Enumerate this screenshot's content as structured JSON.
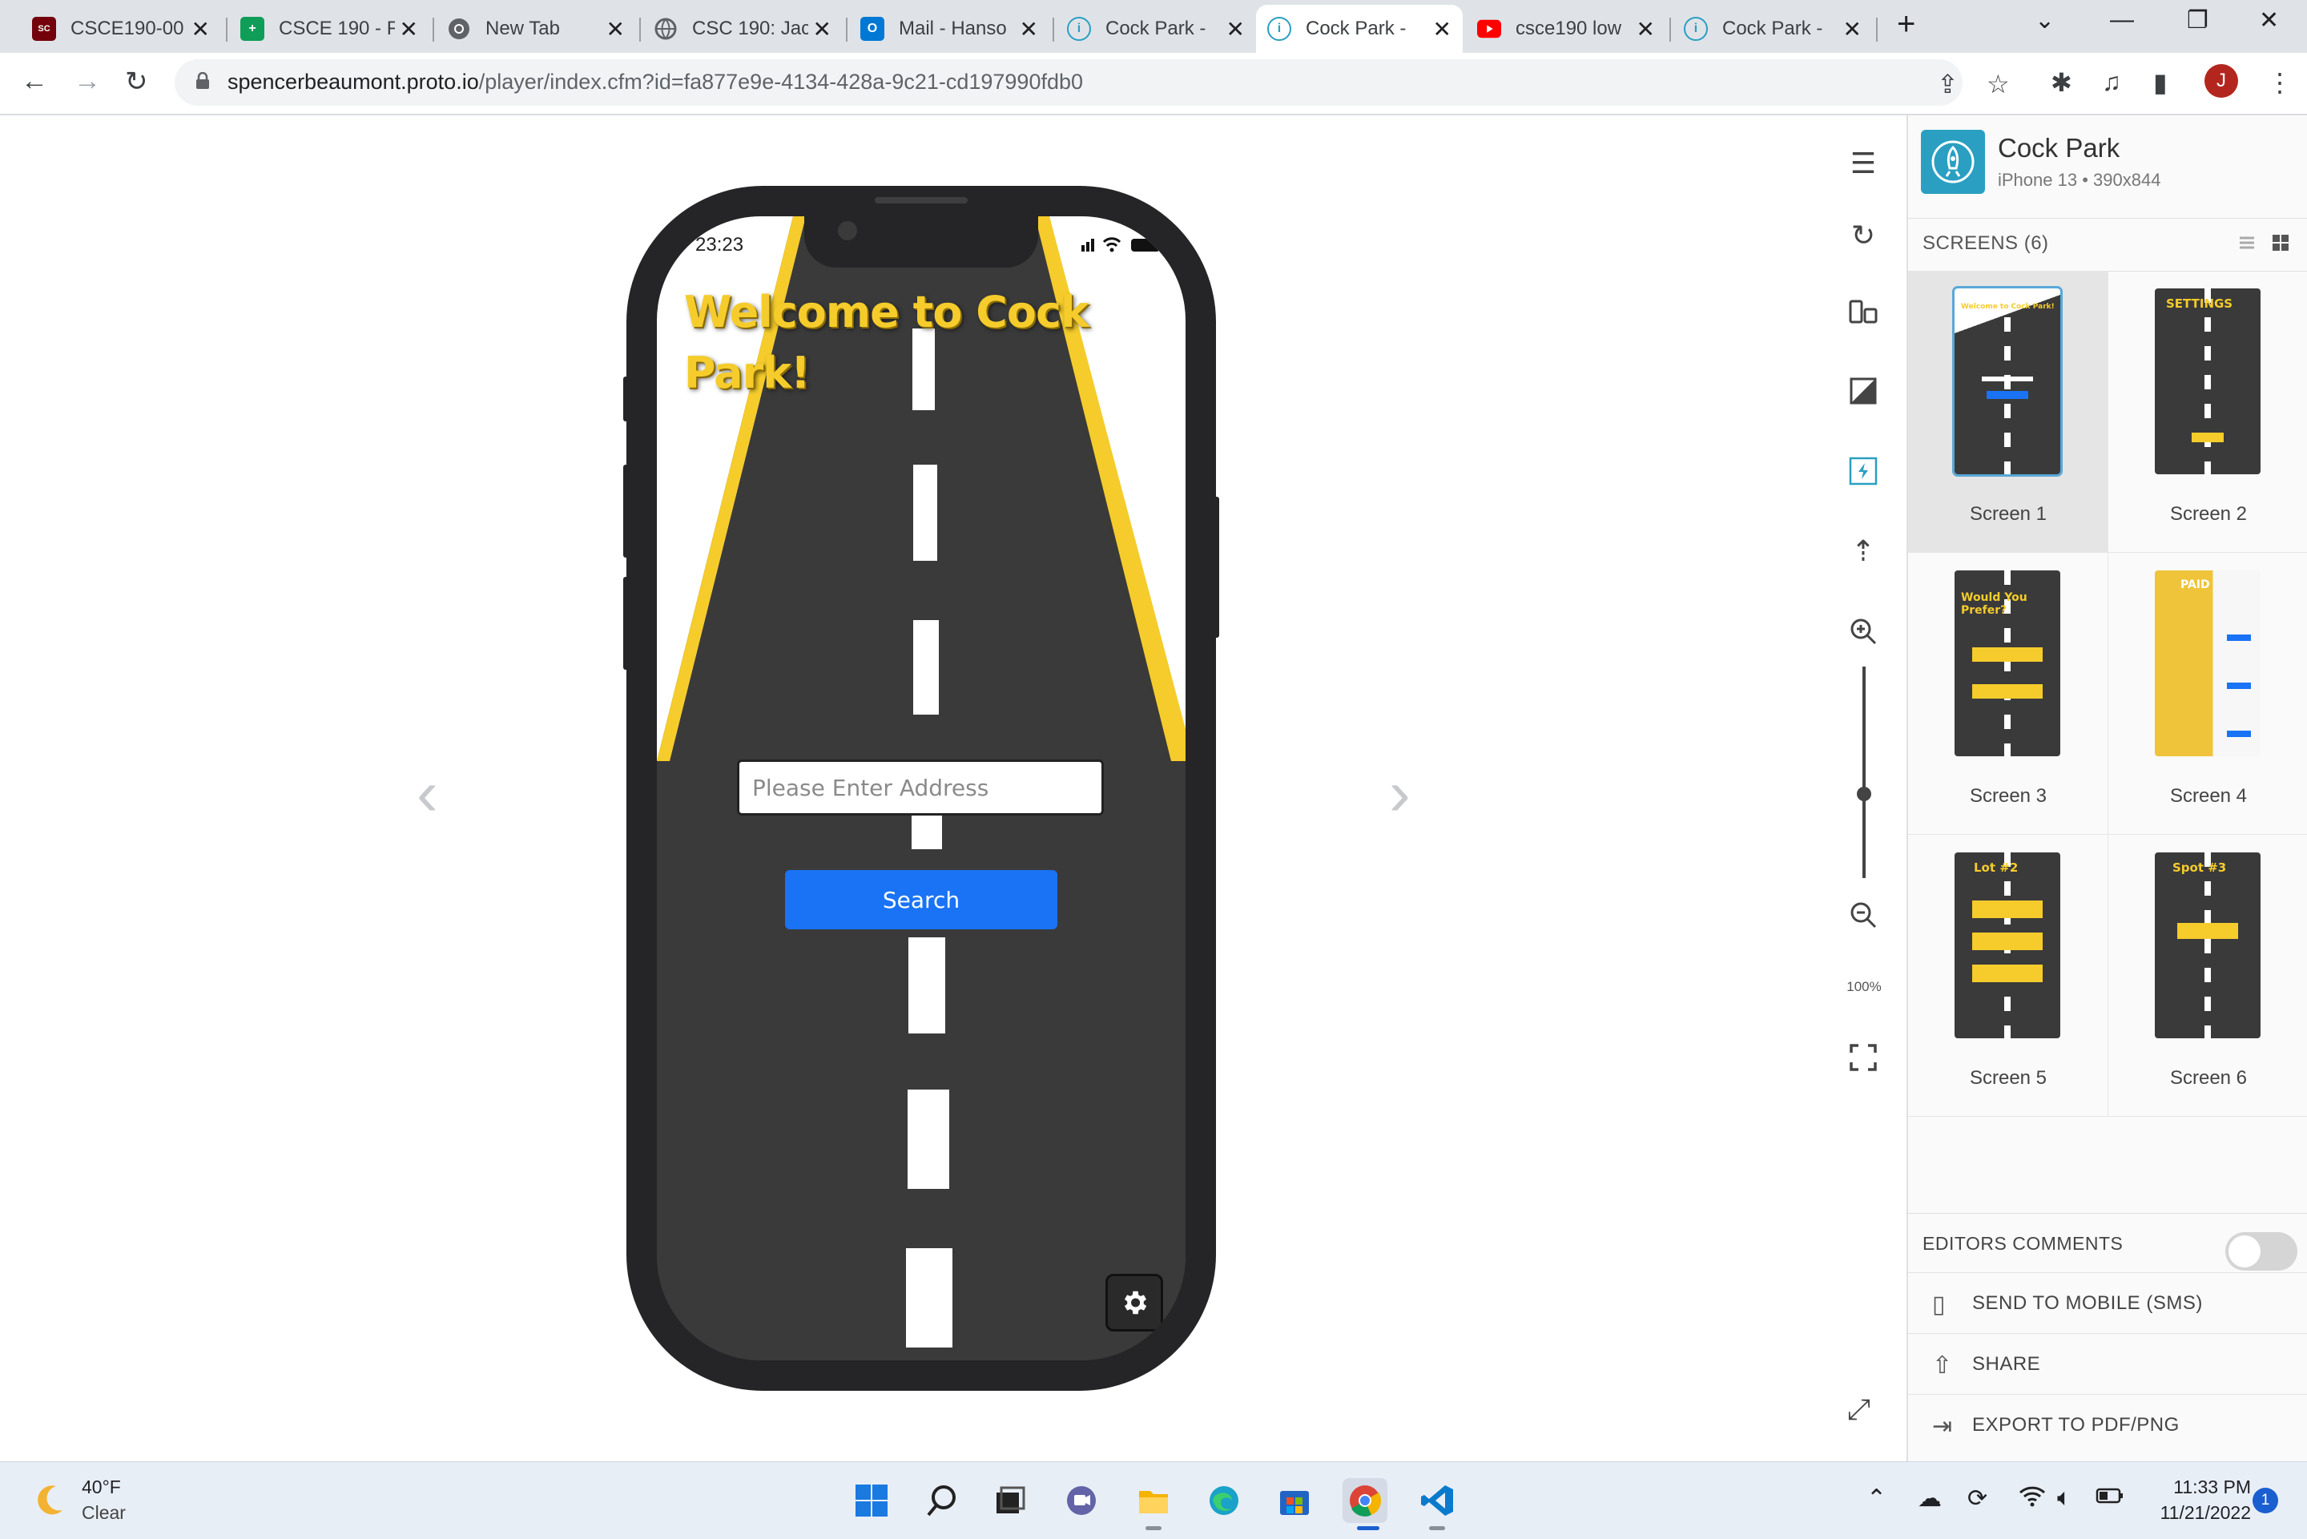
{
  "browser": {
    "tabs": [
      {
        "title": "CSCE190-00",
        "icon": "usc-icon",
        "color": "#73000a"
      },
      {
        "title": "CSCE 190 - F",
        "icon": "sheets-icon",
        "color": "#0f9d58"
      },
      {
        "title": "New Tab",
        "icon": "chrome-icon",
        "color": "#5f6368"
      },
      {
        "title": "CSC 190: Jac",
        "icon": "globe-icon",
        "color": "#5f6368"
      },
      {
        "title": "Mail - Hanso",
        "icon": "outlook-icon",
        "color": "#0078d4"
      },
      {
        "title": "Cock Park - ",
        "icon": "protoio-icon",
        "color": "#2a9fc2"
      },
      {
        "title": "Cock Park - ",
        "icon": "protoio-icon",
        "color": "#2a9fc2"
      },
      {
        "title": "csce190 low",
        "icon": "youtube-icon",
        "color": "#ff0000"
      },
      {
        "title": "Cock Park - ",
        "icon": "protoio-icon",
        "color": "#2a9fc2"
      }
    ],
    "active_tab": 6,
    "url_host": "spencerbeaumont.proto.io",
    "url_path": "/player/index.cfm?id=fa877e9e-4134-428a-9c21-cd197990fdb0",
    "profile_initial": "J"
  },
  "phone": {
    "time": "23:23",
    "welcome": "Welcome to Cock Park!",
    "address_placeholder": "Please Enter Address",
    "search_label": "Search"
  },
  "toolbar": {
    "zoom_level": "100%",
    "zoom_fraction": 0.55
  },
  "panel": {
    "project_name": "Cock Park",
    "device": "iPhone 13 • 390x844",
    "screens_header": "SCREENS (6)",
    "screens": [
      {
        "label": "Screen 1",
        "thumb_title": "Welcome to Cock Park!"
      },
      {
        "label": "Screen 2",
        "thumb_title": "SETTINGS"
      },
      {
        "label": "Screen 3",
        "thumb_title": "Would You Prefer?"
      },
      {
        "label": "Screen 4",
        "thumb_title": "PAID"
      },
      {
        "label": "Screen 5",
        "thumb_title": "Lot #2"
      },
      {
        "label": "Screen 6",
        "thumb_title": "Spot #3"
      }
    ],
    "selected_screen": 0,
    "editors_comments": "EDITORS COMMENTS",
    "send_to_mobile": "SEND TO MOBILE (SMS)",
    "share": "SHARE",
    "export": "EXPORT TO PDF/PNG"
  },
  "taskbar": {
    "temperature": "40°F",
    "condition": "Clear",
    "time": "11:33 PM",
    "date": "11/21/2022",
    "notification_count": "1"
  },
  "colors": {
    "road": "#3a3a3a",
    "yellow": "#f5cc2b",
    "search_blue": "#1a73f5",
    "proto_blue": "#2a9fc2"
  }
}
